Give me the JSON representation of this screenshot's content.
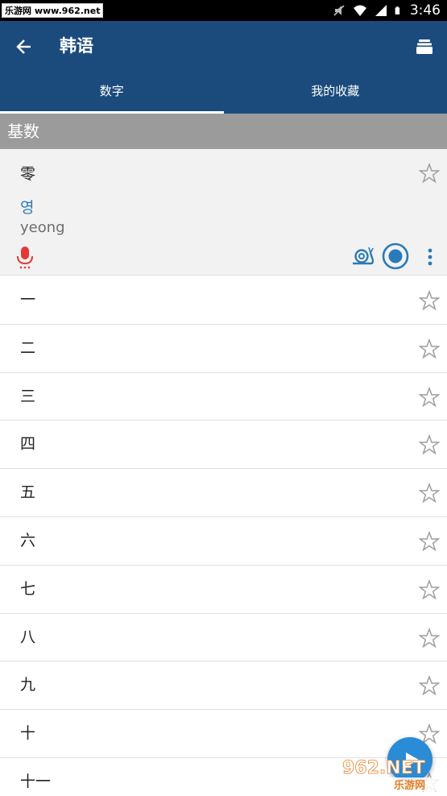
{
  "status_bar": {
    "watermark": "乐游网 www.962.net",
    "time": "3:46",
    "icons": [
      "mute-icon",
      "wifi-icon",
      "battery-icon"
    ]
  },
  "app_bar": {
    "title": "韩语",
    "back_icon": "arrow-left-icon",
    "action_icon": "stack-icon",
    "color": "#1b4b7c"
  },
  "tabs": [
    {
      "label": "数字",
      "active": true
    },
    {
      "label": "我的收藏",
      "active": false
    }
  ],
  "section": {
    "title": "基数",
    "color": "#9b9b9b"
  },
  "expanded_item": {
    "word": "零",
    "korean": "영",
    "romanization": "yeong",
    "korean_color": "#2a7ab8",
    "mic_color": "#e53935",
    "action_color": "#2a7ab8"
  },
  "list_items": [
    {
      "label": "一"
    },
    {
      "label": "二"
    },
    {
      "label": "三"
    },
    {
      "label": "四"
    },
    {
      "label": "五"
    },
    {
      "label": "六"
    },
    {
      "label": "七"
    },
    {
      "label": "八"
    },
    {
      "label": "九"
    },
    {
      "label": "十"
    },
    {
      "label": "十一"
    }
  ],
  "fab": {
    "icon": "play-icon",
    "color": "#2a8bd6"
  },
  "logo_watermark": {
    "text_top": "962.NET",
    "text_bottom": "乐游网"
  }
}
